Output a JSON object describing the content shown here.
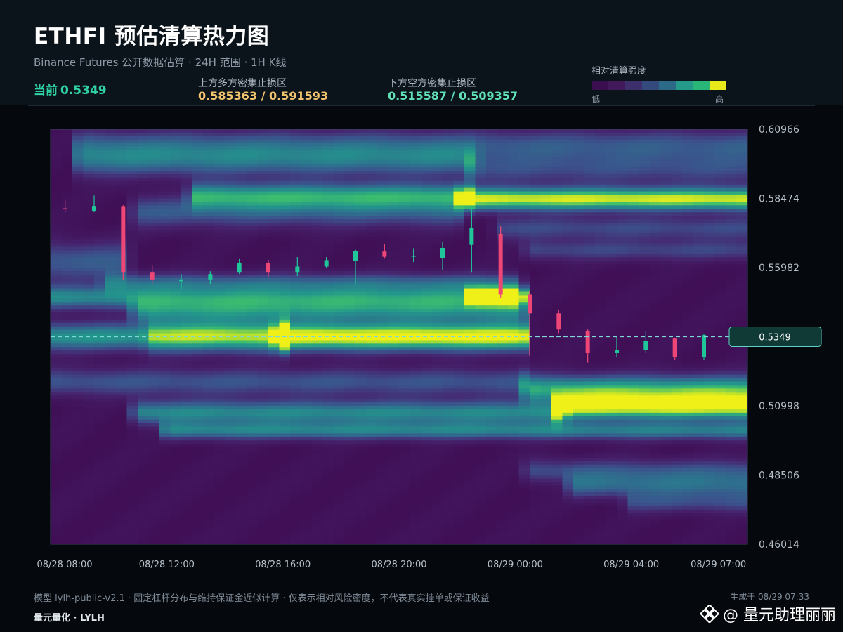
{
  "header": {
    "title": "ETHFI 预估清算热力图",
    "subtitle": "Binance Futures 公开数据估算 · 24H 范围 · 1H K线",
    "current_label": "当前",
    "current_value": "0.5349",
    "upper_label": "上方多方密集止损区",
    "upper_value": "0.585363 / 0.591593",
    "lower_label": "下方空方密集止损区",
    "lower_value": "0.515587 / 0.509357"
  },
  "legend": {
    "title": "相对清算强度",
    "low": "低",
    "high": "高",
    "colors": [
      "#3b0f4f",
      "#421a5c",
      "#3d2f6c",
      "#354a7c",
      "#2c6a88",
      "#269a8a",
      "#2ab676",
      "#e8e81b"
    ]
  },
  "colors": {
    "up_candle": "#1fc69a",
    "down_candle": "#ee4777",
    "current_line": "#7ed8d6",
    "axis_text": "#b7c0c9"
  },
  "footer": {
    "note": "模型 lylh-public-v2.1 · 固定杠杆分布与维持保证金近似计算 · 仅表示相对风险密度，不代表真实挂单或保证收益",
    "generated": "生成于 08/29 07:33",
    "brand": "量元量化 · LYLH",
    "watermark": "@ 量元助理丽丽"
  },
  "chart_data": {
    "type": "heatmap",
    "ylim": [
      0.46014,
      0.60966
    ],
    "y_ticks": [
      "0.60966",
      "0.58474",
      "0.55982",
      "0.53490",
      "0.50998",
      "0.48506",
      "0.46014"
    ],
    "y_tick_labels": [
      "0.60966",
      "0.58474",
      "0.55982",
      "",
      "0.50998",
      "0.48506",
      "0.46014"
    ],
    "x_tick_labels": [
      "08/28 08:00",
      "08/28 12:00",
      "08/28 16:00",
      "08/28 20:00",
      "08/29 00:00",
      "08/29 04:00",
      "08/29 07:00"
    ],
    "x_tick_hours": [
      0,
      4,
      8,
      12,
      16,
      20,
      23
    ],
    "current_price": 0.5349,
    "current_price_label": "0.5349",
    "candles": [
      {
        "h": 0,
        "o": 0.5812,
        "c": 0.5809,
        "hi": 0.584,
        "lo": 0.5797
      },
      {
        "h": 1,
        "o": 0.5802,
        "c": 0.5818,
        "hi": 0.5858,
        "lo": 0.5798
      },
      {
        "h": 2,
        "o": 0.5817,
        "c": 0.558,
        "hi": 0.5823,
        "lo": 0.5553
      },
      {
        "h": 3,
        "o": 0.558,
        "c": 0.5553,
        "hi": 0.5606,
        "lo": 0.554
      },
      {
        "h": 4,
        "o": 0.5553,
        "c": 0.5553,
        "hi": 0.5575,
        "lo": 0.5521
      },
      {
        "h": 5,
        "o": 0.5553,
        "c": 0.5575,
        "hi": 0.5585,
        "lo": 0.5538
      },
      {
        "h": 6,
        "o": 0.558,
        "c": 0.5616,
        "hi": 0.5629,
        "lo": 0.5575
      },
      {
        "h": 7,
        "o": 0.5616,
        "c": 0.558,
        "hi": 0.5626,
        "lo": 0.5563
      },
      {
        "h": 8,
        "o": 0.558,
        "c": 0.5602,
        "hi": 0.5636,
        "lo": 0.5568
      },
      {
        "h": 9,
        "o": 0.5602,
        "c": 0.5625,
        "hi": 0.5636,
        "lo": 0.5596
      },
      {
        "h": 10,
        "o": 0.5623,
        "c": 0.5657,
        "hi": 0.5663,
        "lo": 0.5538
      },
      {
        "h": 11,
        "o": 0.5656,
        "c": 0.5637,
        "hi": 0.5682,
        "lo": 0.563
      },
      {
        "h": 12,
        "o": 0.5638,
        "c": 0.5641,
        "hi": 0.5668,
        "lo": 0.5618
      },
      {
        "h": 13,
        "o": 0.5633,
        "c": 0.5669,
        "hi": 0.569,
        "lo": 0.559
      },
      {
        "h": 14,
        "o": 0.568,
        "c": 0.5741,
        "hi": 0.5815,
        "lo": 0.558
      },
      {
        "h": 15,
        "o": 0.572,
        "c": 0.5501,
        "hi": 0.5747,
        "lo": 0.5488
      },
      {
        "h": 16,
        "o": 0.5501,
        "c": 0.5433,
        "hi": 0.5516,
        "lo": 0.528
      },
      {
        "h": 17,
        "o": 0.5433,
        "c": 0.5375,
        "hi": 0.5444,
        "lo": 0.5362
      },
      {
        "h": 18,
        "o": 0.5368,
        "c": 0.529,
        "hi": 0.5375,
        "lo": 0.5255
      },
      {
        "h": 19,
        "o": 0.529,
        "c": 0.5301,
        "hi": 0.5349,
        "lo": 0.5275
      },
      {
        "h": 20,
        "o": 0.5301,
        "c": 0.5335,
        "hi": 0.5368,
        "lo": 0.5292
      },
      {
        "h": 21,
        "o": 0.5342,
        "c": 0.5275,
        "hi": 0.5345,
        "lo": 0.5267
      },
      {
        "h": 22,
        "o": 0.5275,
        "c": 0.5355,
        "hi": 0.536,
        "lo": 0.5265
      }
    ],
    "bands": [
      {
        "price": 0.5349,
        "h0": 8,
        "h1": 16.3,
        "intensity": 1.0,
        "spread": 0.0035
      },
      {
        "price": 0.5349,
        "h0": 0,
        "h1": 8,
        "intensity": 0.6,
        "spread": 0.0035
      },
      {
        "price": 0.5355,
        "h0": 3.5,
        "h1": 8,
        "intensity": 0.3,
        "spread": 0.0045
      },
      {
        "price": 0.549,
        "h0": 0,
        "h1": 16.2,
        "intensity": 0.55,
        "spread": 0.003
      },
      {
        "price": 0.5495,
        "h0": 14.5,
        "h1": 16.1,
        "intensity": 0.95,
        "spread": 0.002
      },
      {
        "price": 0.544,
        "h0": 3,
        "h1": 16.2,
        "intensity": 0.45,
        "spread": 0.003
      },
      {
        "price": 0.5545,
        "h0": 2,
        "h1": 16,
        "intensity": 0.35,
        "spread": 0.0025
      },
      {
        "price": 0.5845,
        "h0": 14.3,
        "h1": 24,
        "intensity": 0.92,
        "spread": 0.0028
      },
      {
        "price": 0.5858,
        "h0": 5,
        "h1": 14.3,
        "intensity": 0.6,
        "spread": 0.0032
      },
      {
        "price": 0.58,
        "h0": 3,
        "h1": 14,
        "intensity": 0.35,
        "spread": 0.004
      },
      {
        "price": 0.598,
        "h0": 1,
        "h1": 14.5,
        "intensity": 0.4,
        "spread": 0.004
      },
      {
        "price": 0.604,
        "h0": 1,
        "h1": 24,
        "intensity": 0.33,
        "spread": 0.004
      },
      {
        "price": 0.5955,
        "h0": 14.5,
        "h1": 24,
        "intensity": 0.28,
        "spread": 0.004
      },
      {
        "price": 0.574,
        "h0": 15.5,
        "h1": 24,
        "intensity": 0.28,
        "spread": 0.003
      },
      {
        "price": 0.566,
        "h0": 16.5,
        "h1": 24,
        "intensity": 0.26,
        "spread": 0.0025
      },
      {
        "price": 0.5185,
        "h0": 0,
        "h1": 16.3,
        "intensity": 0.32,
        "spread": 0.0035
      },
      {
        "price": 0.516,
        "h0": 16.5,
        "h1": 24,
        "intensity": 0.68,
        "spread": 0.0035
      },
      {
        "price": 0.5095,
        "h0": 17.5,
        "h1": 24,
        "intensity": 0.92,
        "spread": 0.0032
      },
      {
        "price": 0.5075,
        "h0": 3,
        "h1": 17.5,
        "intensity": 0.55,
        "spread": 0.003
      },
      {
        "price": 0.501,
        "h0": 4,
        "h1": 24,
        "intensity": 0.5,
        "spread": 0.0022
      },
      {
        "price": 0.4865,
        "h0": 16.5,
        "h1": 24,
        "intensity": 0.3,
        "spread": 0.003
      },
      {
        "price": 0.481,
        "h0": 18,
        "h1": 24,
        "intensity": 0.38,
        "spread": 0.003
      },
      {
        "price": 0.475,
        "h0": 20,
        "h1": 24,
        "intensity": 0.26,
        "spread": 0.0025
      },
      {
        "price": 0.562,
        "h0": 0,
        "h1": 2.5,
        "intensity": 0.35,
        "spread": 0.005
      }
    ]
  }
}
